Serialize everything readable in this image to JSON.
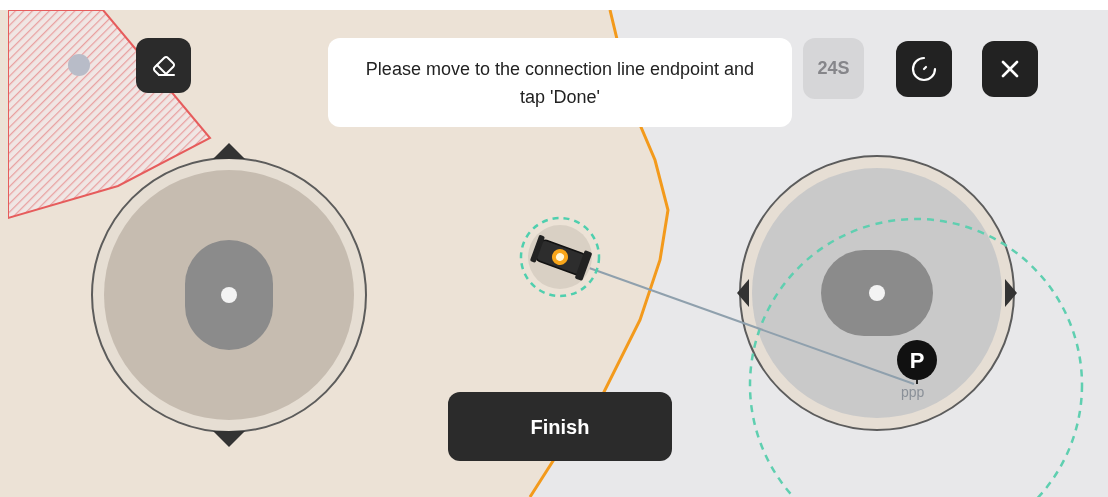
{
  "prompt": "Please move to the connection line endpoint and tap 'Done'",
  "timer": {
    "label": "24S",
    "disabled": true
  },
  "joysticks": [
    {
      "kind": "vertical"
    },
    {
      "kind": "horizontal"
    }
  ],
  "pin": {
    "label": "P",
    "name": "ppp"
  },
  "finish_button": "Finish"
}
